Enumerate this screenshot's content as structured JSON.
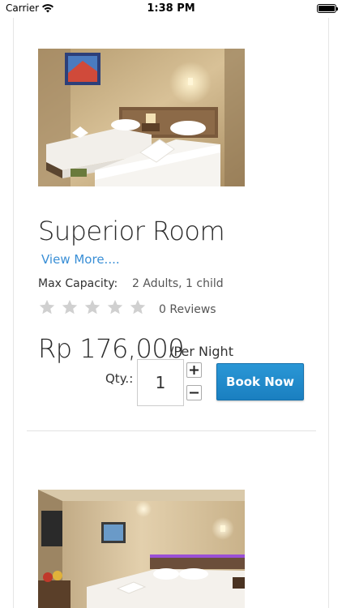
{
  "status_bar": {
    "carrier": "Carrier",
    "time": "1:38 PM"
  },
  "room": {
    "title": "Superior Room",
    "view_more": "View More....",
    "capacity_label": "Max Capacity:",
    "capacity_value": "2 Adults, 1 child",
    "rating_stars_filled": 0,
    "rating_stars_total": 5,
    "reviews": "0 Reviews",
    "price": "Rp 176,000",
    "per_night": "/Per Night",
    "qty_label": "Qty.:",
    "qty_value": "1",
    "book_label": "Book Now"
  },
  "colors": {
    "link": "#3a8fd6",
    "book_button": "#1e88c9",
    "star_empty": "#d0d0d0"
  }
}
